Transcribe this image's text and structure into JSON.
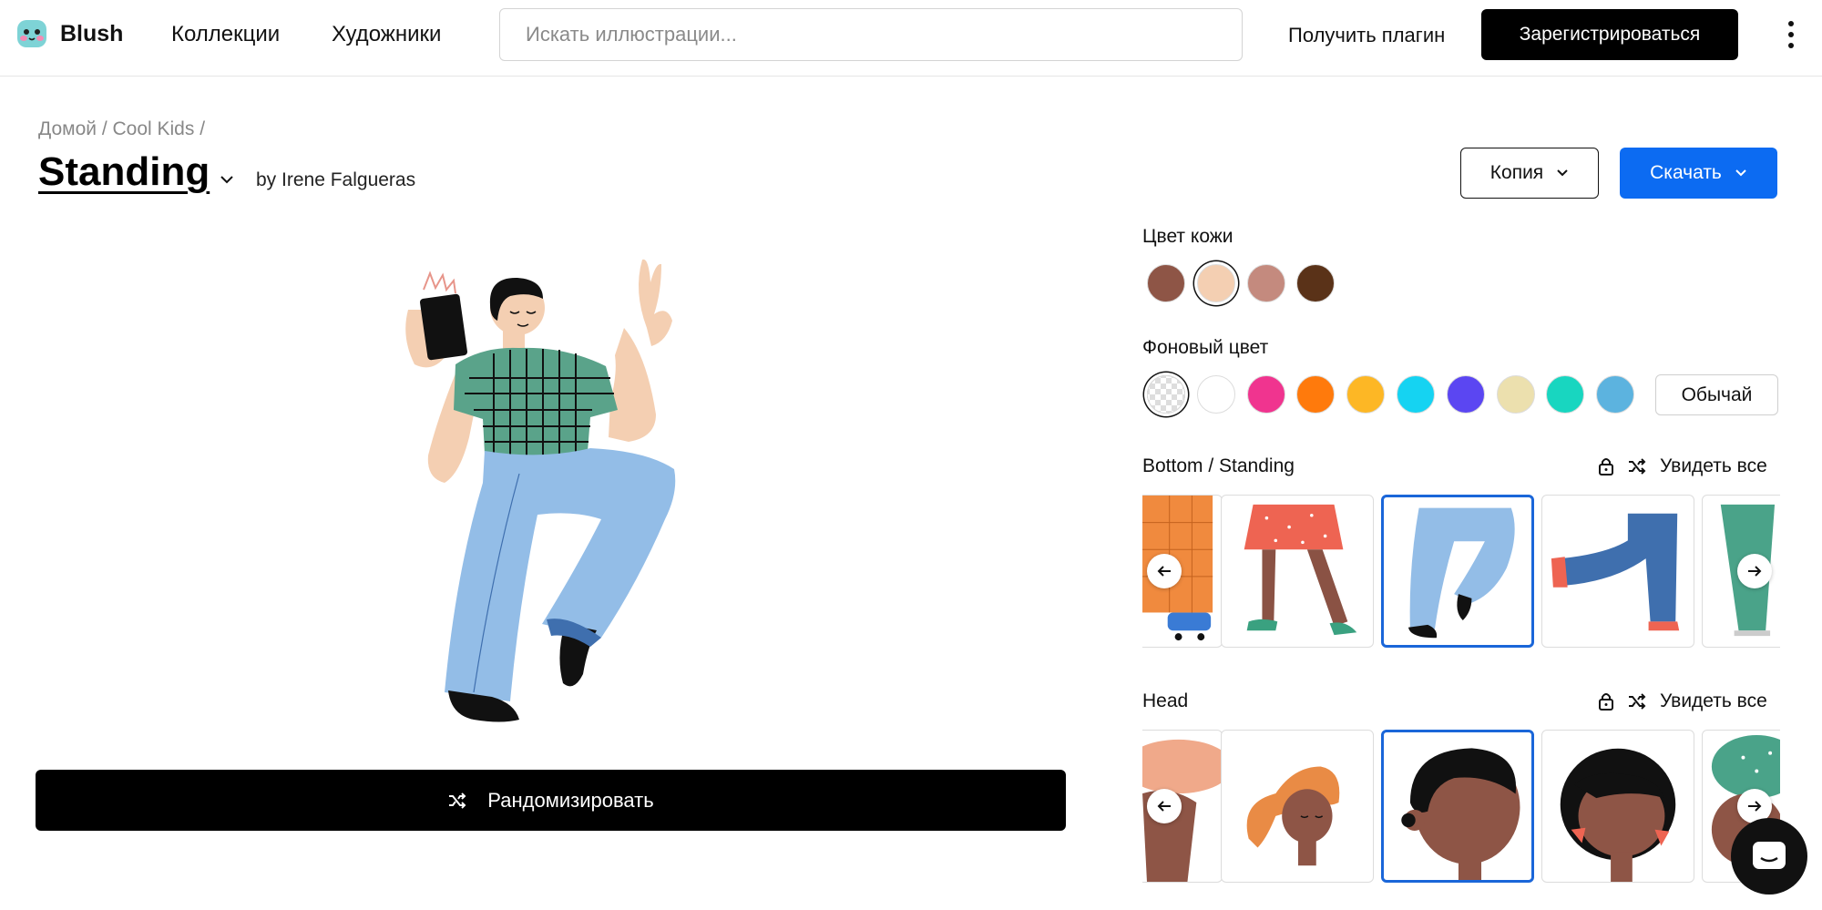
{
  "header": {
    "logo_text": "Blush",
    "nav": [
      "Коллекции",
      "Художники"
    ],
    "search_placeholder": "Искать иллюстрации...",
    "plugin_link": "Получить плагин",
    "signup_button": "Зарегистрироваться"
  },
  "page": {
    "breadcrumb": "Домой / Cool Kids /",
    "title": "Standing",
    "author": "by Irene Falgueras",
    "copy_button": "Копия",
    "download_button": "Скачать",
    "randomize_button": "Рандомизировать"
  },
  "panel": {
    "skin_label": "Цвет кожи",
    "skin_colors": [
      "#8e5546",
      "#f4cfb2",
      "#c48a7e",
      "#5a3218"
    ],
    "skin_selected": 1,
    "background_label": "Фоновый цвет",
    "background_colors": [
      "transparent",
      "#ffffff",
      "#f0348f",
      "#ff7a0c",
      "#fdb725",
      "#15d3f2",
      "#5b46f2",
      "#ece0ae",
      "#18d6c0",
      "#5cb3df"
    ],
    "background_selected": 0,
    "custom_button": "Обычай",
    "sections": [
      {
        "title": "Bottom / Standing",
        "see_all": "Увидеть все",
        "selected_index": 2
      },
      {
        "title": "Head",
        "see_all": "Увидеть все",
        "selected_index": 2
      }
    ]
  },
  "colors": {
    "primary": "#0c6bf2",
    "selected_border": "#1a66d9",
    "dark": "#000000"
  }
}
